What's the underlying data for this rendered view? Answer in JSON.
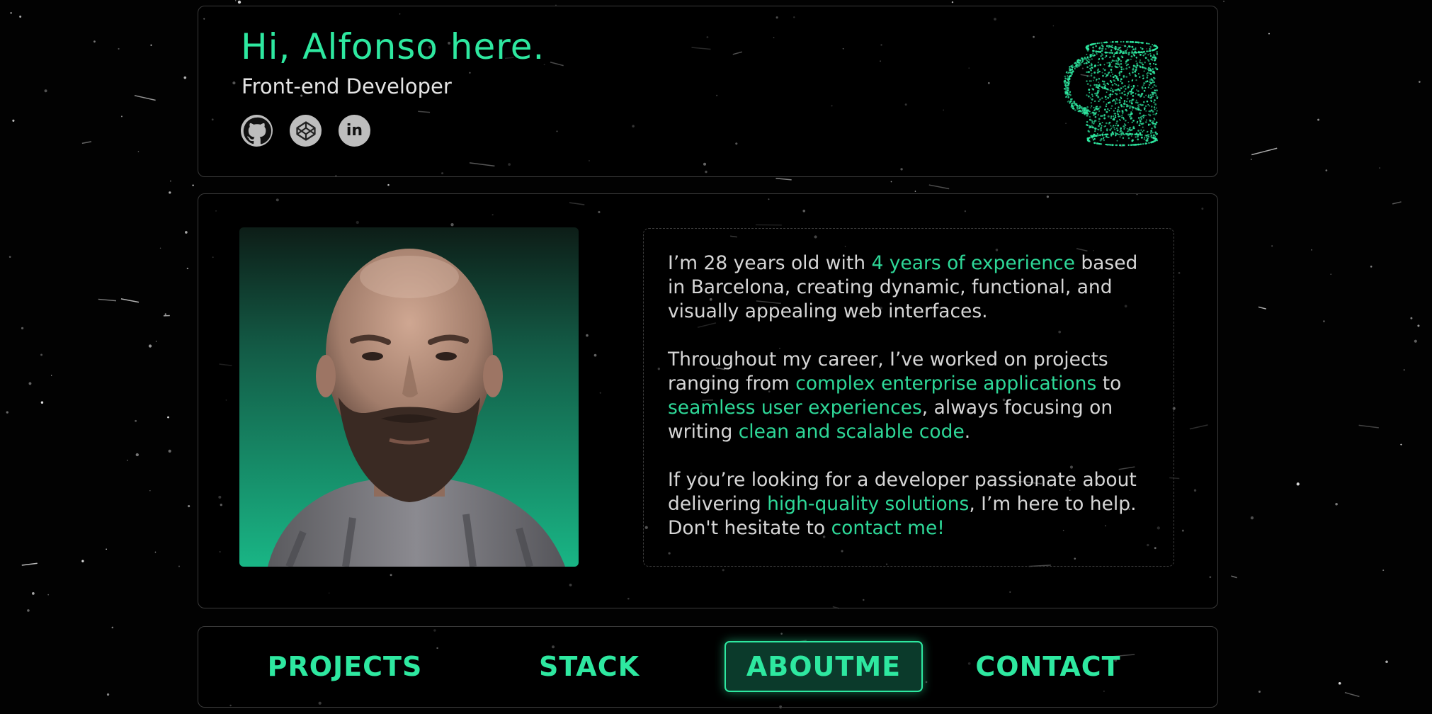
{
  "header": {
    "greeting": "Hi, Alfonso here.",
    "role": "Front-end Developer",
    "socials": [
      {
        "icon": "github-icon",
        "label": "GitHub"
      },
      {
        "icon": "codepen-icon",
        "label": "CodePen"
      },
      {
        "icon": "linkedin-icon",
        "label": "in"
      }
    ],
    "mug_icon": "coffee-mug-icon"
  },
  "about": {
    "paragraphs": [
      [
        {
          "text": "I’m 28 years old with "
        },
        {
          "text": "4 years of experience",
          "hl": true
        },
        {
          "text": " based in Barcelona, creating dynamic, functional, and visually appealing web interfaces."
        }
      ],
      [
        {
          "text": "Throughout my career, I’ve worked on projects ranging from "
        },
        {
          "text": "complex enterprise applications",
          "hl": true
        },
        {
          "text": " to "
        },
        {
          "text": "seamless user experiences",
          "hl": true
        },
        {
          "text": ", always focusing on writing "
        },
        {
          "text": "clean and scalable code",
          "hl": true
        },
        {
          "text": "."
        }
      ],
      [
        {
          "text": "If you’re looking for a developer passionate about delivering "
        },
        {
          "text": "high-quality solutions",
          "hl": true
        },
        {
          "text": ", I’m here to help. Don't hesitate to "
        },
        {
          "text": "contact me!",
          "hl": true
        }
      ]
    ]
  },
  "nav": {
    "items": [
      {
        "label": "PROJECTS",
        "active": false
      },
      {
        "label": "STACK",
        "active": false
      },
      {
        "label": "ABOUTME",
        "active": true
      },
      {
        "label": "CONTACT",
        "active": false
      }
    ]
  },
  "colors": {
    "accent": "#2ee8a0",
    "background": "#020202",
    "photo_bg": "#17a37a"
  }
}
